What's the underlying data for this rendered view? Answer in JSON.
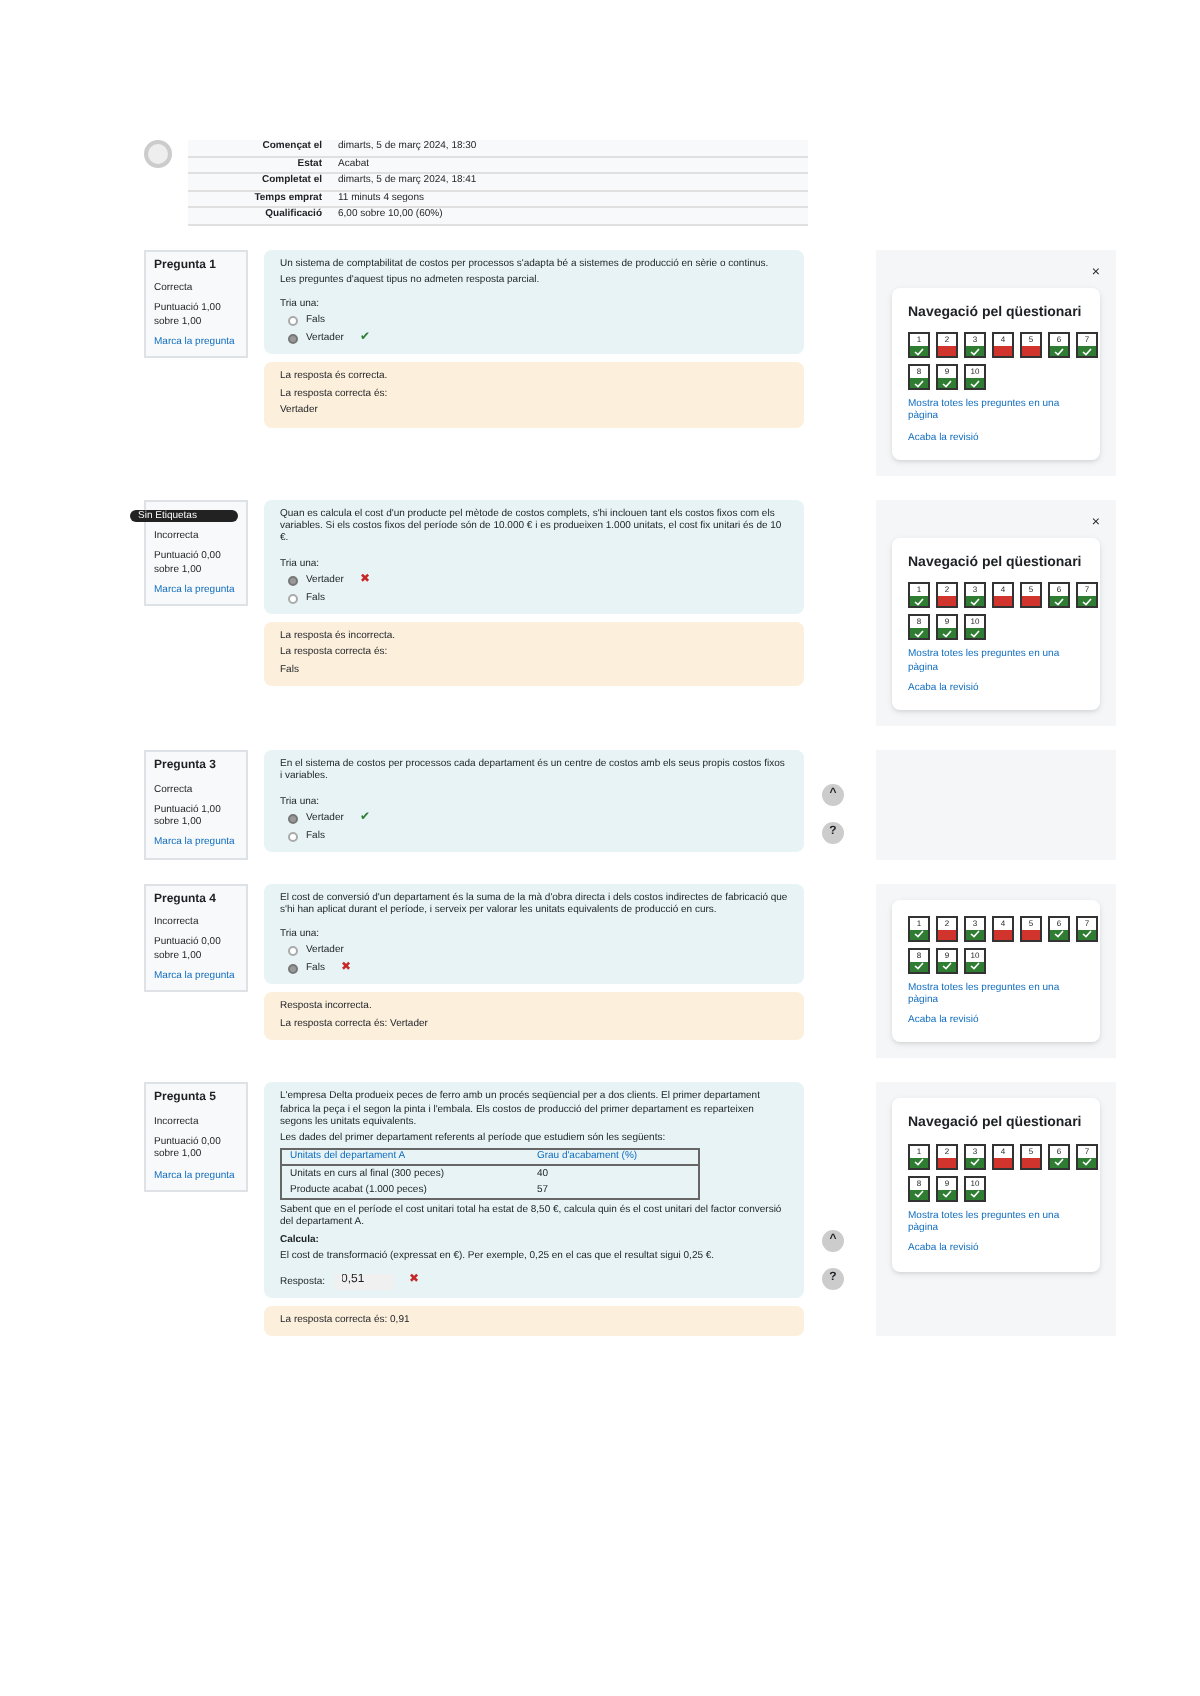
{
  "summary": [
    {
      "label": "Començat el",
      "value": "dimarts, 5 de març 2024, 18:30"
    },
    {
      "label": "Estat",
      "value": "Acabat"
    },
    {
      "label": "Completat el",
      "value": "dimarts, 5 de març 2024, 18:41"
    },
    {
      "label": "Temps emprat",
      "value": "11 minuts 4 segons"
    },
    {
      "label": "Qualificació",
      "value": "6,00 sobre 10,00 (60%)"
    }
  ],
  "sections": [
    {
      "info": {
        "number": "Pregunta 1",
        "status": "Correcta",
        "score": "Puntuació 1,00 sobre 1,00",
        "flag": "Marca la pregunta"
      },
      "question": [
        "Un sistema de comptabilitat de costos per processos s'adapta bé a sistemes de producció en sèrie o continus.",
        "Les preguntes d'aquest tipus no admeten resposta parcial."
      ],
      "prompt": "Tria una:",
      "options": [
        {
          "label": "Fals",
          "selected": false
        },
        {
          "label": "Vertader",
          "selected": true,
          "kind": "correct",
          "mark": "✔"
        }
      ],
      "feedback": [
        "La resposta és correcta.",
        "La resposta correcta és:",
        "Vertader"
      ],
      "nav": {
        "title": "Navegació pel qüestionari",
        "close": "×",
        "buttons": [
          {
            "label": "1",
            "correct": true
          },
          {
            "label": "2",
            "correct": false
          },
          {
            "label": "3",
            "correct": true
          },
          {
            "label": "4",
            "correct": false
          },
          {
            "label": "5",
            "correct": false
          },
          {
            "label": "6",
            "correct": true
          },
          {
            "label": "7",
            "correct": true
          },
          {
            "label": "8",
            "correct": true
          },
          {
            "label": "9",
            "correct": true
          },
          {
            "label": "10",
            "correct": true
          }
        ],
        "links": [
          "Mostra totes les preguntes en una pàgina",
          "Acaba la revisió"
        ]
      }
    },
    {
      "info": {
        "tag": "Sin Etiquetas",
        "status": "Incorrecta",
        "score": "Puntuació 0,00 sobre 1,00",
        "flag": "Marca la pregunta"
      },
      "question": [
        "Quan es calcula el cost d'un producte pel mètode de costos complets, s'hi inclouen tant els costos fixos com els variables. Si els costos fixos del període són de 10.000 € i es produeixen 1.000 unitats, el cost fix unitari és de 10 €."
      ],
      "prompt": "Tria una:",
      "options": [
        {
          "label": "Vertader",
          "selected": true,
          "kind": "incorrect",
          "mark": "✖"
        },
        {
          "label": "Fals",
          "selected": false
        }
      ],
      "feedback": [
        "La resposta és incorrecta.",
        "La resposta correcta és:",
        "Fals"
      ],
      "nav": {
        "title": "Navegació pel qüestionari",
        "close": "×",
        "buttons": [
          {
            "label": "1",
            "correct": true
          },
          {
            "label": "2",
            "correct": false
          },
          {
            "label": "3",
            "correct": true
          },
          {
            "label": "4",
            "correct": false
          },
          {
            "label": "5",
            "correct": false
          },
          {
            "label": "6",
            "correct": true
          },
          {
            "label": "7",
            "correct": true
          },
          {
            "label": "8",
            "correct": true
          },
          {
            "label": "9",
            "correct": true
          },
          {
            "label": "10",
            "correct": true
          }
        ],
        "links": [
          "Mostra totes les preguntes en una pàgina",
          "Acaba la revisió"
        ]
      }
    },
    {
      "info": {
        "number": "Pregunta 3",
        "status": "Correcta",
        "score": "Puntuació 1,00 sobre 1,00",
        "flag": "Marca la pregunta"
      },
      "question": [
        "En el sistema de costos per processos cada departament és un centre de costos amb els seus propis costos fixos i variables."
      ],
      "prompt": "Tria una:",
      "options": [
        {
          "label": "Vertader",
          "selected": true,
          "kind": "correct",
          "mark": "✔"
        },
        {
          "label": "Fals",
          "selected": false
        }
      ],
      "scroll_buttons": [
        "^",
        "?"
      ]
    },
    {
      "info": {
        "number": "Pregunta 4",
        "status": "Incorrecta",
        "score": "Puntuació 0,00 sobre 1,00",
        "flag": "Marca la pregunta"
      },
      "question": [
        "El cost de conversió d'un departament és la suma de la mà d'obra directa i dels costos indirectes de fabricació que s'hi han aplicat durant el període, i serveix per valorar les unitats equivalents de producció en curs."
      ],
      "prompt": "Tria una:",
      "options": [
        {
          "label": "Vertader",
          "selected": false
        },
        {
          "label": "Fals",
          "selected": true,
          "kind": "incorrect",
          "mark": "✖"
        }
      ],
      "feedback": [
        "Resposta incorrecta.",
        "La resposta correcta és: Vertader"
      ],
      "nav": {
        "buttons": [
          {
            "label": "1",
            "correct": true
          },
          {
            "label": "2",
            "correct": false
          },
          {
            "label": "3",
            "correct": true
          },
          {
            "label": "4",
            "correct": false
          },
          {
            "label": "5",
            "correct": false
          },
          {
            "label": "6",
            "correct": true
          },
          {
            "label": "7",
            "correct": true
          },
          {
            "label": "8",
            "correct": true
          },
          {
            "label": "9",
            "correct": true
          },
          {
            "label": "10",
            "correct": true
          }
        ],
        "links": [
          "Mostra totes les preguntes en una pàgina",
          "Acaba la revisió"
        ]
      }
    },
    {
      "info": {
        "number": "Pregunta 5",
        "status": "Incorrecta",
        "score": "Puntuació 0,00 sobre 1,00",
        "flag": "Marca la pregunta"
      },
      "question": [
        "L'empresa Delta produeix peces de ferro amb un procés seqüencial per a dos clients. El primer departament fabrica la peça i el segon la pinta i l'embala. Els costos de producció del primer departament es reparteixen segons les unitats equivalents.",
        "Les dades del primer departament referents al període que estudiem són les següents:"
      ],
      "table": {
        "columns": [
          "Unitats del departament A",
          "Grau d'acabament (%)"
        ],
        "rows": [
          [
            "Unitats en curs al final (300 peces)",
            "40"
          ],
          [
            "Producte acabat (1.000 peces)",
            "57"
          ]
        ]
      },
      "after": [
        "Sabent que en el període el cost unitari total ha estat de 8,50 €, calcula quin és el cost unitari del factor conversió del departament A."
      ],
      "calc_title": "Calcula:",
      "calc_text": "El cost de transformació (expressat en €). Per exemple, 0,25 en el cas que el resultat sigui 0,25 €.",
      "answer": {
        "label": "Resposta:",
        "value": "0,51",
        "kind": "incorrect",
        "mark": "✖"
      },
      "feedback": [
        "La resposta correcta és: 0,91"
      ],
      "nav": {
        "title": "Navegació pel qüestionari",
        "buttons": [
          {
            "label": "1",
            "correct": true
          },
          {
            "label": "2",
            "correct": false
          },
          {
            "label": "3",
            "correct": true
          },
          {
            "label": "4",
            "correct": false
          },
          {
            "label": "5",
            "correct": false
          },
          {
            "label": "6",
            "correct": true
          },
          {
            "label": "7",
            "correct": true
          },
          {
            "label": "8",
            "correct": true
          },
          {
            "label": "9",
            "correct": true
          },
          {
            "label": "10",
            "correct": true
          }
        ],
        "links": [
          "Mostra totes les preguntes en una pàgina",
          "Acaba la revisió"
        ]
      },
      "scroll_buttons": [
        "^",
        "?"
      ]
    }
  ]
}
